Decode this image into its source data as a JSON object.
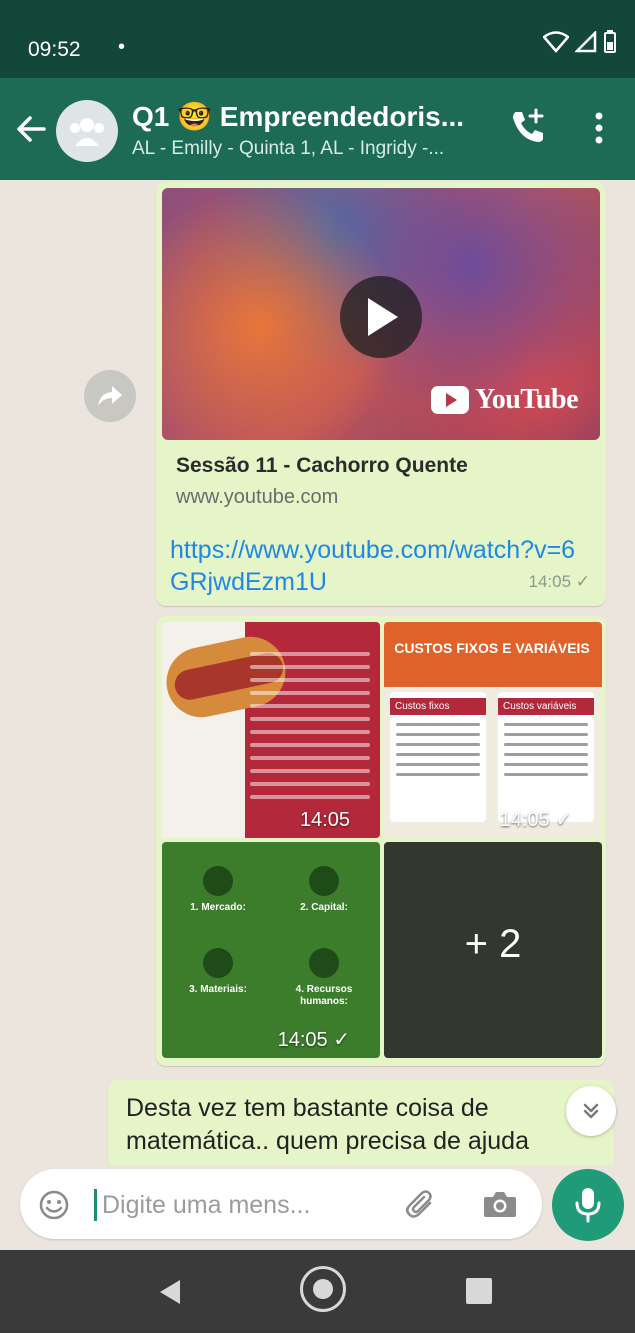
{
  "status_bar": {
    "time": "09:52",
    "dot": "•"
  },
  "header": {
    "title": "Q1 🤓 Empreendedoris...",
    "subtitle": "AL - Emilly - Quinta 1, AL - Ingridy -..."
  },
  "messages": {
    "link_preview": {
      "brand": "YouTube",
      "title": "Sessão 11 - Cachorro Quente",
      "domain": "www.youtube.com",
      "url": "https://www.youtube.com/watch?v=6GRjwdEzm1U",
      "time": "14:05 ✓"
    },
    "album": {
      "image1_time": "14:05",
      "image2_title": "CUSTOS FIXOS E VARIÁVEIS",
      "image2_col1": "Custos fixos",
      "image2_col2": "Custos variáveis",
      "image2_time": "14:05 ✓",
      "image3_items": [
        {
          "label": "1. Mercado:"
        },
        {
          "label": "2. Capital:"
        },
        {
          "label": "3. Materiais:"
        },
        {
          "label": "4. Recursos humanos:"
        }
      ],
      "image3_time": "14:05 ✓",
      "more_count": "+ 2"
    },
    "text_message": "Desta vez tem bastante coisa de matemática.. quem precisa de ajuda"
  },
  "composer": {
    "placeholder": "Digite uma mens..."
  },
  "colors": {
    "header": "#1d6b55",
    "status_bar": "#12473a",
    "outgoing_bubble": "#e5f5c8",
    "mic_button": "#1f9b77",
    "link": "#1e88e5"
  }
}
